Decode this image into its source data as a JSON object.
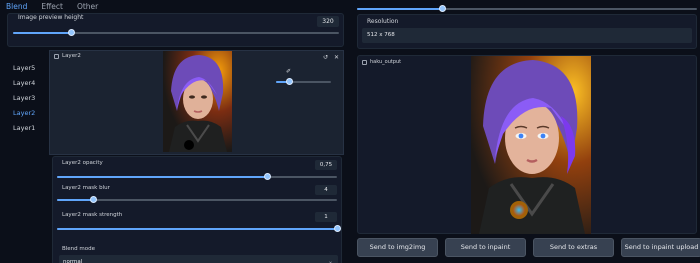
{
  "tabs": [
    {
      "label": "Blend",
      "active": true
    },
    {
      "label": "Effect",
      "active": false
    },
    {
      "label": "Other",
      "active": false
    }
  ],
  "preview": {
    "label": "Image preview height",
    "value": "320",
    "fraction": 0.18
  },
  "layers": [
    "Layer5",
    "Layer4",
    "Layer3",
    "Layer2",
    "Layer1"
  ],
  "active_layer": "Layer2",
  "layer_panel": {
    "title": "Layer2",
    "brush_size_fraction": 0.25
  },
  "controls": {
    "opacity": {
      "label": "Layer2 opacity",
      "value": "0,75",
      "fraction": 0.75
    },
    "mask_blur": {
      "label": "Layer2 mask blur",
      "value": "4",
      "fraction": 0.13
    },
    "mask_strength": {
      "label": "Layer2 mask strength",
      "value": "1",
      "fraction": 1.0
    }
  },
  "blend": {
    "label": "Blend mode",
    "value": "normal"
  },
  "right": {
    "top_slider_fraction": 0.25,
    "resolution_label": "Resolution",
    "resolution_value": "512 x 768",
    "output_title": "haku_output"
  },
  "buttons": [
    "Send to img2img",
    "Send to inpaint",
    "Send to extras",
    "Send to inpaint upload"
  ],
  "colors": {
    "accent": "#60a5fa",
    "background": "#0b0f19"
  }
}
